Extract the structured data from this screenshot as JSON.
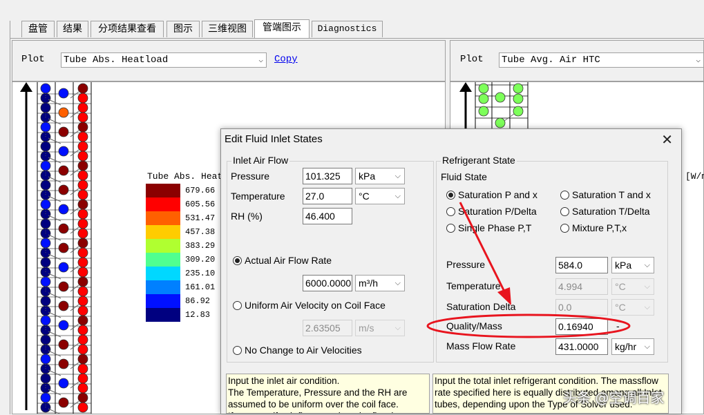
{
  "tabs": [
    {
      "label": "盘管"
    },
    {
      "label": "结果"
    },
    {
      "label": "分项结果查看"
    },
    {
      "label": "图示"
    },
    {
      "label": "三维视图"
    },
    {
      "label": "管端图示"
    },
    {
      "label": "Diagnostics"
    }
  ],
  "left_plot": {
    "label": "Plot",
    "selected": "Tube Abs. Heatload",
    "copy": "Copy"
  },
  "right_plot": {
    "label": "Plot",
    "selected": "Tube Avg. Air HTC",
    "units_partial": "[W/m"
  },
  "legend": {
    "title": "Tube Abs. Heat",
    "entries": [
      {
        "value": "679.66",
        "color": "#8b0000"
      },
      {
        "value": "605.56",
        "color": "#ff0000"
      },
      {
        "value": "531.47",
        "color": "#ff6000"
      },
      {
        "value": "457.38",
        "color": "#ffcc00"
      },
      {
        "value": "383.29",
        "color": "#b0ff30"
      },
      {
        "value": "309.20",
        "color": "#50ff90"
      },
      {
        "value": "235.10",
        "color": "#00d8ff"
      },
      {
        "value": "161.01",
        "color": "#0080ff"
      },
      {
        "value": "86.92",
        "color": "#0010ff"
      },
      {
        "value": "12.83",
        "color": "#000080"
      }
    ]
  },
  "dialog": {
    "title": "Edit Fluid Inlet States",
    "air": {
      "group_title": "Inlet Air Flow",
      "pressure_label": "Pressure",
      "pressure_value": "101.325",
      "pressure_unit": "kPa",
      "temperature_label": "Temperature",
      "temperature_value": "27.0",
      "temperature_unit": "°C",
      "rh_label": "RH (%)",
      "rh_value": "46.400",
      "opt_actual": "Actual Air Flow Rate",
      "flow_value": "6000.0000",
      "flow_unit": "m³/h",
      "opt_uniform": "Uniform Air Velocity on Coil Face",
      "velocity_value": "2.63505",
      "velocity_unit": "m/s",
      "opt_nochange": "No Change to Air Velocities"
    },
    "refrigerant": {
      "group_title": "Refrigerant State",
      "fluid_state_label": "Fluid State",
      "opt_sat_px": "Saturation P and x",
      "opt_sat_tx": "Saturation T and x",
      "opt_sat_pdelta": "Saturation P/Delta",
      "opt_sat_tdelta": "Saturation T/Delta",
      "opt_single": "Single Phase P,T",
      "opt_mixture": "Mixture P,T,x",
      "pressure_label": "Pressure",
      "pressure_value": "584.0",
      "pressure_unit": "kPa",
      "temperature_label": "Temperature",
      "temperature_value": "4.994",
      "temperature_unit": "°C",
      "satdelta_label": "Saturation Delta",
      "satdelta_value": "0.0",
      "satdelta_unit": "°C",
      "quality_label": "Quality/Mass",
      "quality_value": "0.16940",
      "quality_unit": "-",
      "massflow_label": "Mass Flow Rate",
      "massflow_value": "431.0000",
      "massflow_unit": "kg/hr"
    },
    "air_note": "Input the inlet air condition.\nThe Temperature, Pressure and the RH are assumed to be uniform over the coil face.\nIf you specify air flow rate then the flow is",
    "ref_note": "Input the total inlet refrigerant condition. The massflow rate specified here is equally distributed among all Inlet tubes, depending upon the Type of Solver used."
  },
  "colors": {
    "annotation_red": "#e8141e"
  },
  "watermark": "头条 @空调百家"
}
